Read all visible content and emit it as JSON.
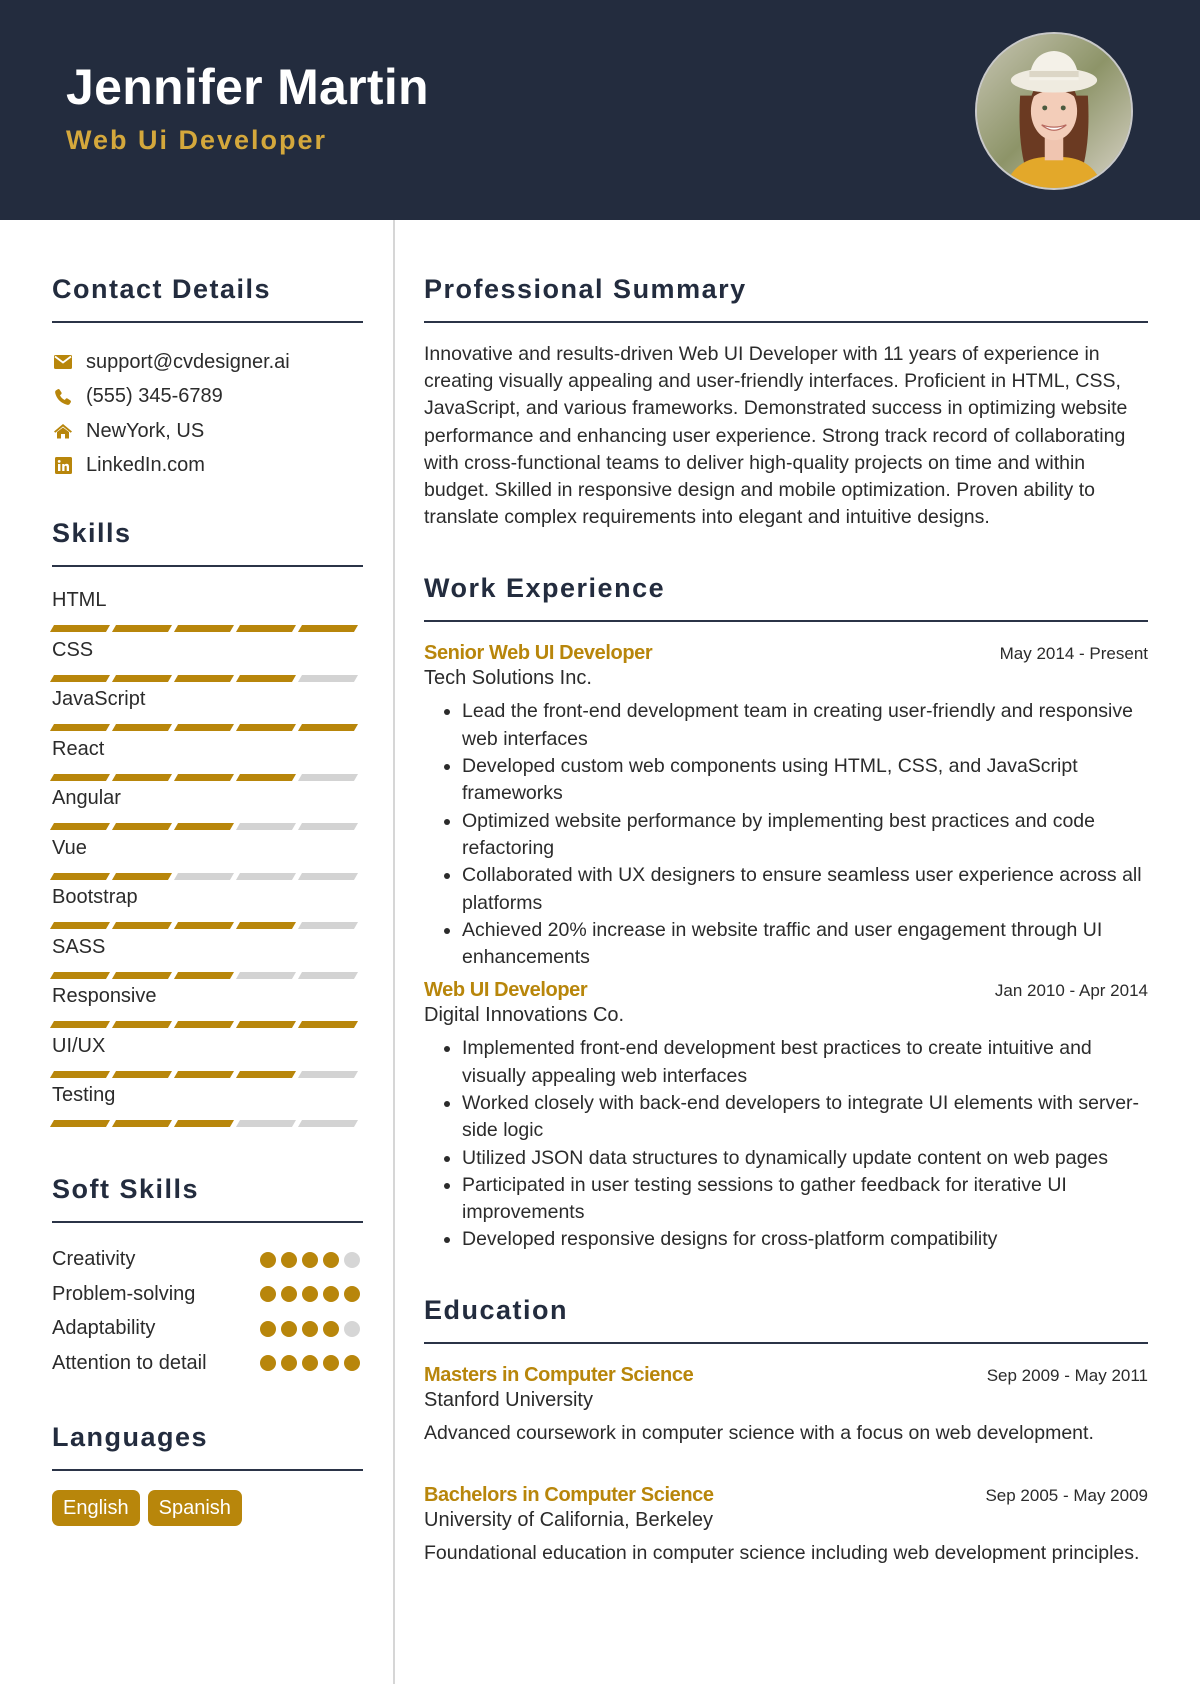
{
  "header": {
    "name": "Jennifer Martin",
    "title": "Web Ui Developer"
  },
  "colors": {
    "header_bg": "#232c3e",
    "accent": "#b8860b",
    "title_gold": "#d4a83c",
    "inactive": "#d3d3d3"
  },
  "contact": {
    "heading": "Contact Details",
    "items": [
      {
        "icon": "envelope-icon",
        "text": "support@cvdesigner.ai"
      },
      {
        "icon": "phone-icon",
        "text": "(555) 345-6789"
      },
      {
        "icon": "home-icon",
        "text": "NewYork, US"
      },
      {
        "icon": "linkedin-icon",
        "text": "LinkedIn.com"
      }
    ]
  },
  "skills": {
    "heading": "Skills",
    "max_level": 5,
    "items": [
      {
        "name": "HTML",
        "level": 5
      },
      {
        "name": "CSS",
        "level": 4
      },
      {
        "name": "JavaScript",
        "level": 5
      },
      {
        "name": "React",
        "level": 4
      },
      {
        "name": "Angular",
        "level": 3
      },
      {
        "name": "Vue",
        "level": 2
      },
      {
        "name": "Bootstrap",
        "level": 4
      },
      {
        "name": "SASS",
        "level": 3
      },
      {
        "name": "Responsive",
        "level": 5
      },
      {
        "name": "UI/UX",
        "level": 4
      },
      {
        "name": "Testing",
        "level": 3
      }
    ]
  },
  "soft_skills": {
    "heading": "Soft Skills",
    "max_level": 5,
    "items": [
      {
        "name": "Creativity",
        "level": 4
      },
      {
        "name": "Problem-solving",
        "level": 5
      },
      {
        "name": "Adaptability",
        "level": 4
      },
      {
        "name": "Attention to detail",
        "level": 5
      }
    ]
  },
  "languages": {
    "heading": "Languages",
    "items": [
      "English",
      "Spanish"
    ]
  },
  "summary": {
    "heading": "Professional Summary",
    "text": "Innovative and results-driven Web UI Developer with 11 years of experience in creating visually appealing and user-friendly interfaces. Proficient in HTML, CSS, JavaScript, and various frameworks. Demonstrated success in optimizing website performance and enhancing user experience. Strong track record of collaborating with cross-functional teams to deliver high-quality projects on time and within budget. Skilled in responsive design and mobile optimization. Proven ability to translate complex requirements into elegant and intuitive designs."
  },
  "work": {
    "heading": "Work Experience",
    "jobs": [
      {
        "role": "Senior Web UI Developer",
        "dates": "May 2014 - Present",
        "company": "Tech Solutions Inc.",
        "bullets": [
          "Lead the front-end development team in creating user-friendly and responsive web interfaces",
          "Developed custom web components using HTML, CSS, and JavaScript frameworks",
          "Optimized website performance by implementing best practices and code refactoring",
          "Collaborated with UX designers to ensure seamless user experience across all platforms",
          "Achieved 20% increase in website traffic and user engagement through UI enhancements"
        ]
      },
      {
        "role": "Web UI Developer",
        "dates": "Jan 2010 - Apr 2014",
        "company": "Digital Innovations Co.",
        "bullets": [
          "Implemented front-end development best practices to create intuitive and visually appealing web interfaces",
          "Worked closely with back-end developers to integrate UI elements with server-side logic",
          "Utilized JSON data structures to dynamically update content on web pages",
          "Participated in user testing sessions to gather feedback for iterative UI improvements",
          "Developed responsive designs for cross-platform compatibility"
        ]
      }
    ]
  },
  "education": {
    "heading": "Education",
    "items": [
      {
        "degree": "Masters in Computer Science",
        "dates": "Sep 2009 - May 2011",
        "school": "Stanford University",
        "description": "Advanced coursework in computer science with a focus on web development."
      },
      {
        "degree": "Bachelors in Computer Science",
        "dates": "Sep 2005 - May 2009",
        "school": "University of California, Berkeley",
        "description": "Foundational education in computer science including web development principles."
      }
    ]
  }
}
